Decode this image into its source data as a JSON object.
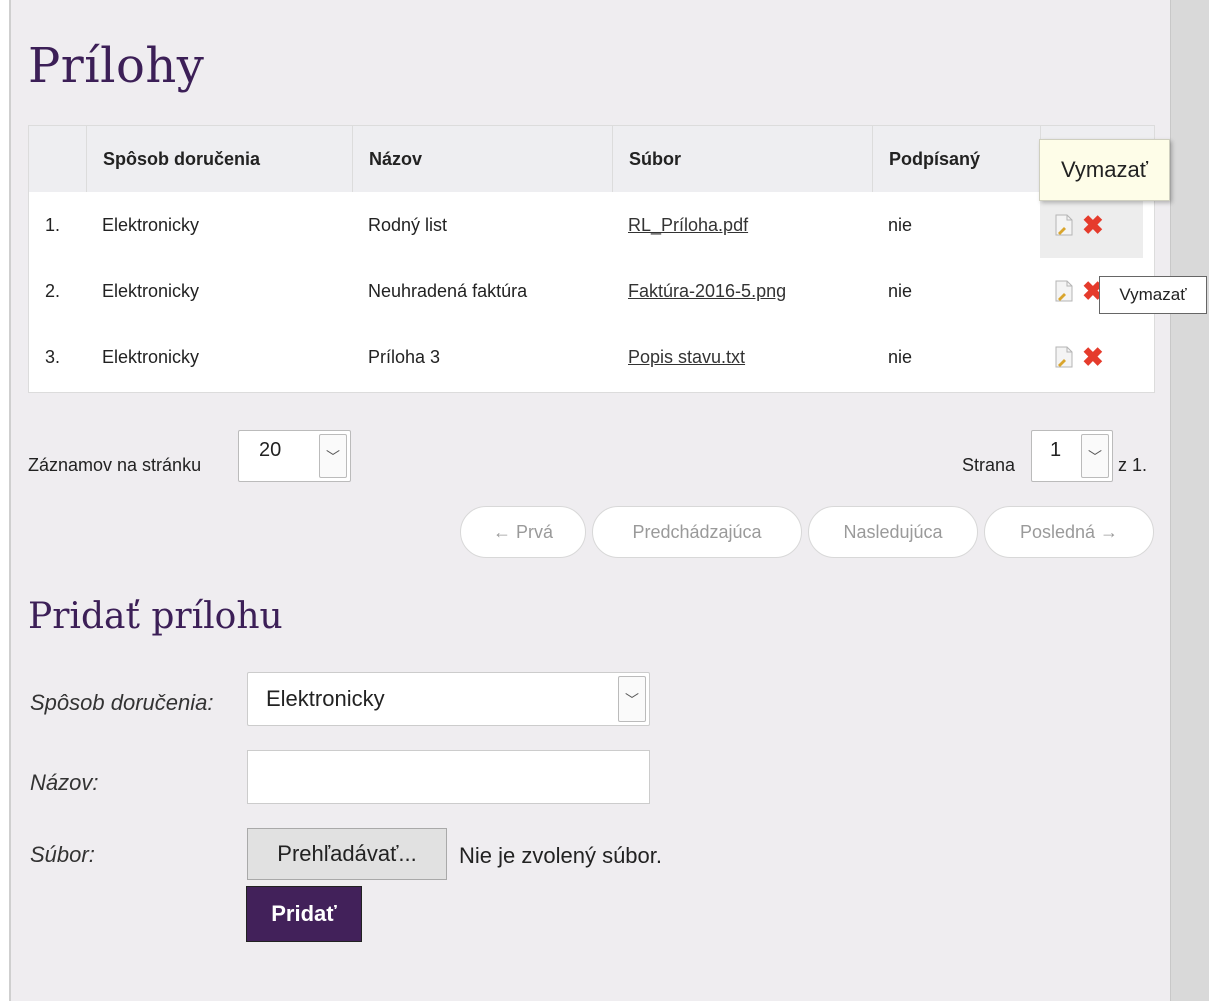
{
  "page": {
    "title": "Prílohy",
    "add_title": "Pridať prílohu"
  },
  "table": {
    "headers": [
      "",
      "Spôsob doručenia",
      "Názov",
      "Súbor",
      "Podpísaný",
      ""
    ],
    "rows": [
      {
        "index": "1.",
        "delivery": "Elektronicky",
        "name": "Rodný list",
        "file": "RL_Príloha.pdf",
        "signed": "nie"
      },
      {
        "index": "2.",
        "delivery": "Elektronicky",
        "name": "Neuhradená faktúra",
        "file": "Faktúra-2016-5.png",
        "signed": "nie"
      },
      {
        "index": "3.",
        "delivery": "Elektronicky",
        "name": "Príloha 3",
        "file": "Popis stavu.txt",
        "signed": "nie"
      }
    ],
    "row_icons": [
      "edit-document-icon",
      "delete-icon"
    ]
  },
  "tooltips": {
    "delete_large": "Vymazať",
    "delete_small": "Vymazať"
  },
  "pager": {
    "per_page_label": "Záznamov na stránku",
    "per_page_value": "20",
    "page_label": "Strana",
    "page_value": "1",
    "page_total": "z 1.",
    "first": "← Prvá",
    "prev": "Predchádzajúca",
    "next": "Nasledujúca",
    "last": "Posledná →"
  },
  "form": {
    "delivery_label": "Spôsob doručenia:",
    "delivery_value": "Elektronicky",
    "name_label": "Názov:",
    "name_value": "",
    "file_label": "Súbor:",
    "browse_label": "Prehľadávať...",
    "file_status": "Nie je zvolený súbor.",
    "submit_label": "Pridať"
  },
  "colors": {
    "accent": "#42215a",
    "heading": "#3c1f57",
    "delete": "#e53b2c",
    "panel_bg": "#efedf0"
  }
}
